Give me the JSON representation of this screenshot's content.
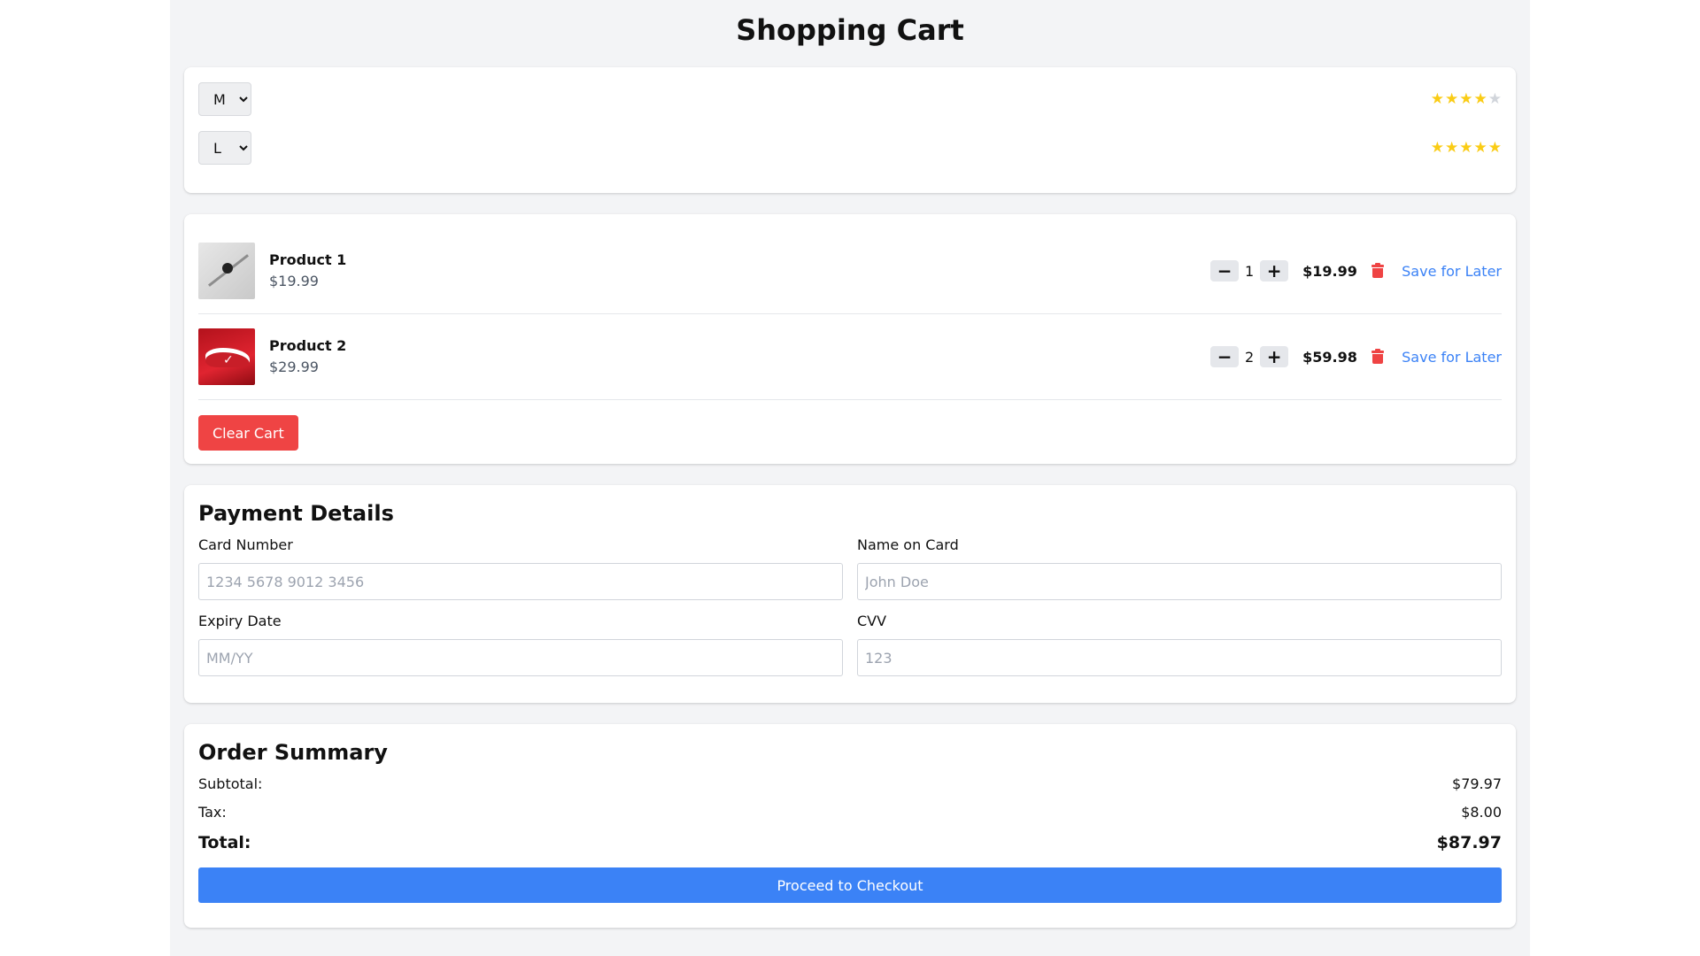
{
  "page": {
    "title": "Shopping Cart"
  },
  "options": [
    {
      "size": "M",
      "rating": 4,
      "max_rating": 5
    },
    {
      "size": "L",
      "rating": 5,
      "max_rating": 5
    }
  ],
  "cart": {
    "items": [
      {
        "name": "Product 1",
        "price": "$19.99",
        "quantity": "1",
        "line_total": "$19.99",
        "save_label": "Save for Later"
      },
      {
        "name": "Product 2",
        "price": "$29.99",
        "quantity": "2",
        "line_total": "$59.98",
        "save_label": "Save for Later"
      }
    ],
    "clear_label": "Clear Cart"
  },
  "payment": {
    "title": "Payment Details",
    "card_number": {
      "label": "Card Number",
      "placeholder": "1234 5678 9012 3456"
    },
    "name_on_card": {
      "label": "Name on Card",
      "placeholder": "John Doe"
    },
    "expiry": {
      "label": "Expiry Date",
      "placeholder": "MM/YY"
    },
    "cvv": {
      "label": "CVV",
      "placeholder": "123"
    }
  },
  "summary": {
    "title": "Order Summary",
    "subtotal_label": "Subtotal:",
    "subtotal_value": "$79.97",
    "tax_label": "Tax:",
    "tax_value": "$8.00",
    "total_label": "Total:",
    "total_value": "$87.97",
    "checkout_label": "Proceed to Checkout"
  },
  "colors": {
    "accent": "#3b82f6",
    "danger": "#ef4444",
    "star": "#facc15",
    "star_off": "#d1d5db"
  }
}
